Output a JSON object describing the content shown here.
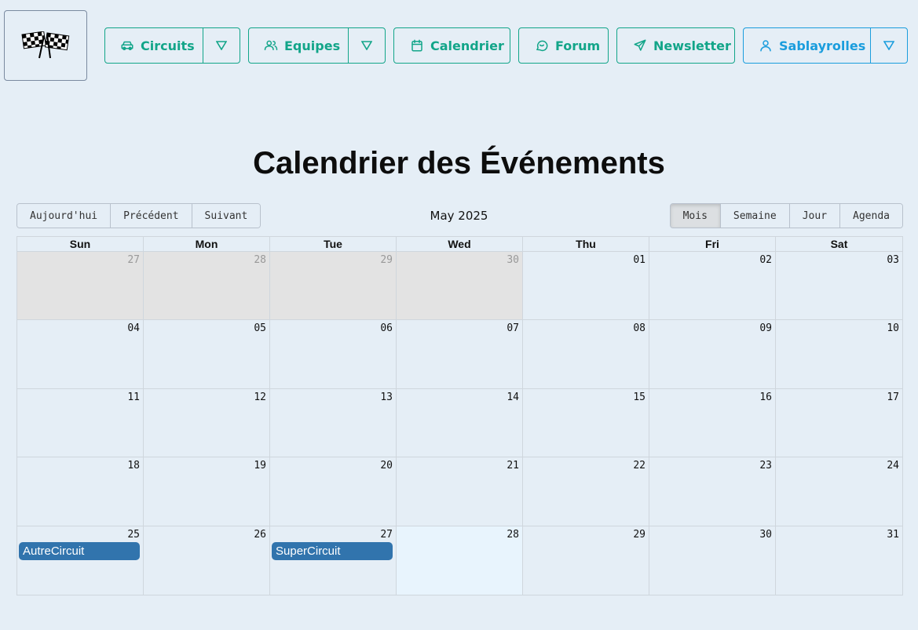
{
  "nav": {
    "circuits": {
      "label": "Circuits",
      "icon": "car-icon"
    },
    "equipes": {
      "label": "Equipes",
      "icon": "users-icon"
    },
    "calendrier": {
      "label": "Calendrier",
      "icon": "calendar-icon"
    },
    "forum": {
      "label": "Forum",
      "icon": "chat-icon"
    },
    "newsletter": {
      "label": "Newsletter",
      "icon": "send-icon"
    },
    "user": {
      "label": "Sablayrolles",
      "icon": "user-icon"
    },
    "accent": "#12a589",
    "user_accent": "#1a9ddd"
  },
  "page": {
    "title": "Calendrier des Événements"
  },
  "toolbar": {
    "today": "Aujourd'hui",
    "prev": "Précédent",
    "next": "Suivant",
    "label": "May 2025",
    "views": [
      "Mois",
      "Semaine",
      "Jour",
      "Agenda"
    ],
    "active_view": "Mois"
  },
  "calendar": {
    "weekdays": [
      "Sun",
      "Mon",
      "Tue",
      "Wed",
      "Thu",
      "Fri",
      "Sat"
    ],
    "days": [
      {
        "n": "27",
        "off": true
      },
      {
        "n": "28",
        "off": true
      },
      {
        "n": "29",
        "off": true
      },
      {
        "n": "30",
        "off": true
      },
      {
        "n": "01"
      },
      {
        "n": "02"
      },
      {
        "n": "03"
      },
      {
        "n": "04"
      },
      {
        "n": "05"
      },
      {
        "n": "06"
      },
      {
        "n": "07"
      },
      {
        "n": "08"
      },
      {
        "n": "09"
      },
      {
        "n": "10"
      },
      {
        "n": "11"
      },
      {
        "n": "12"
      },
      {
        "n": "13"
      },
      {
        "n": "14"
      },
      {
        "n": "15"
      },
      {
        "n": "16"
      },
      {
        "n": "17"
      },
      {
        "n": "18"
      },
      {
        "n": "19"
      },
      {
        "n": "20"
      },
      {
        "n": "21"
      },
      {
        "n": "22"
      },
      {
        "n": "23"
      },
      {
        "n": "24"
      },
      {
        "n": "25",
        "event": "AutreCircuit"
      },
      {
        "n": "26"
      },
      {
        "n": "27",
        "event": "SuperCircuit"
      },
      {
        "n": "28",
        "today": true
      },
      {
        "n": "29"
      },
      {
        "n": "30"
      },
      {
        "n": "31"
      }
    ],
    "event_color": "#3174ad",
    "today_color": "#e8f4fd"
  }
}
